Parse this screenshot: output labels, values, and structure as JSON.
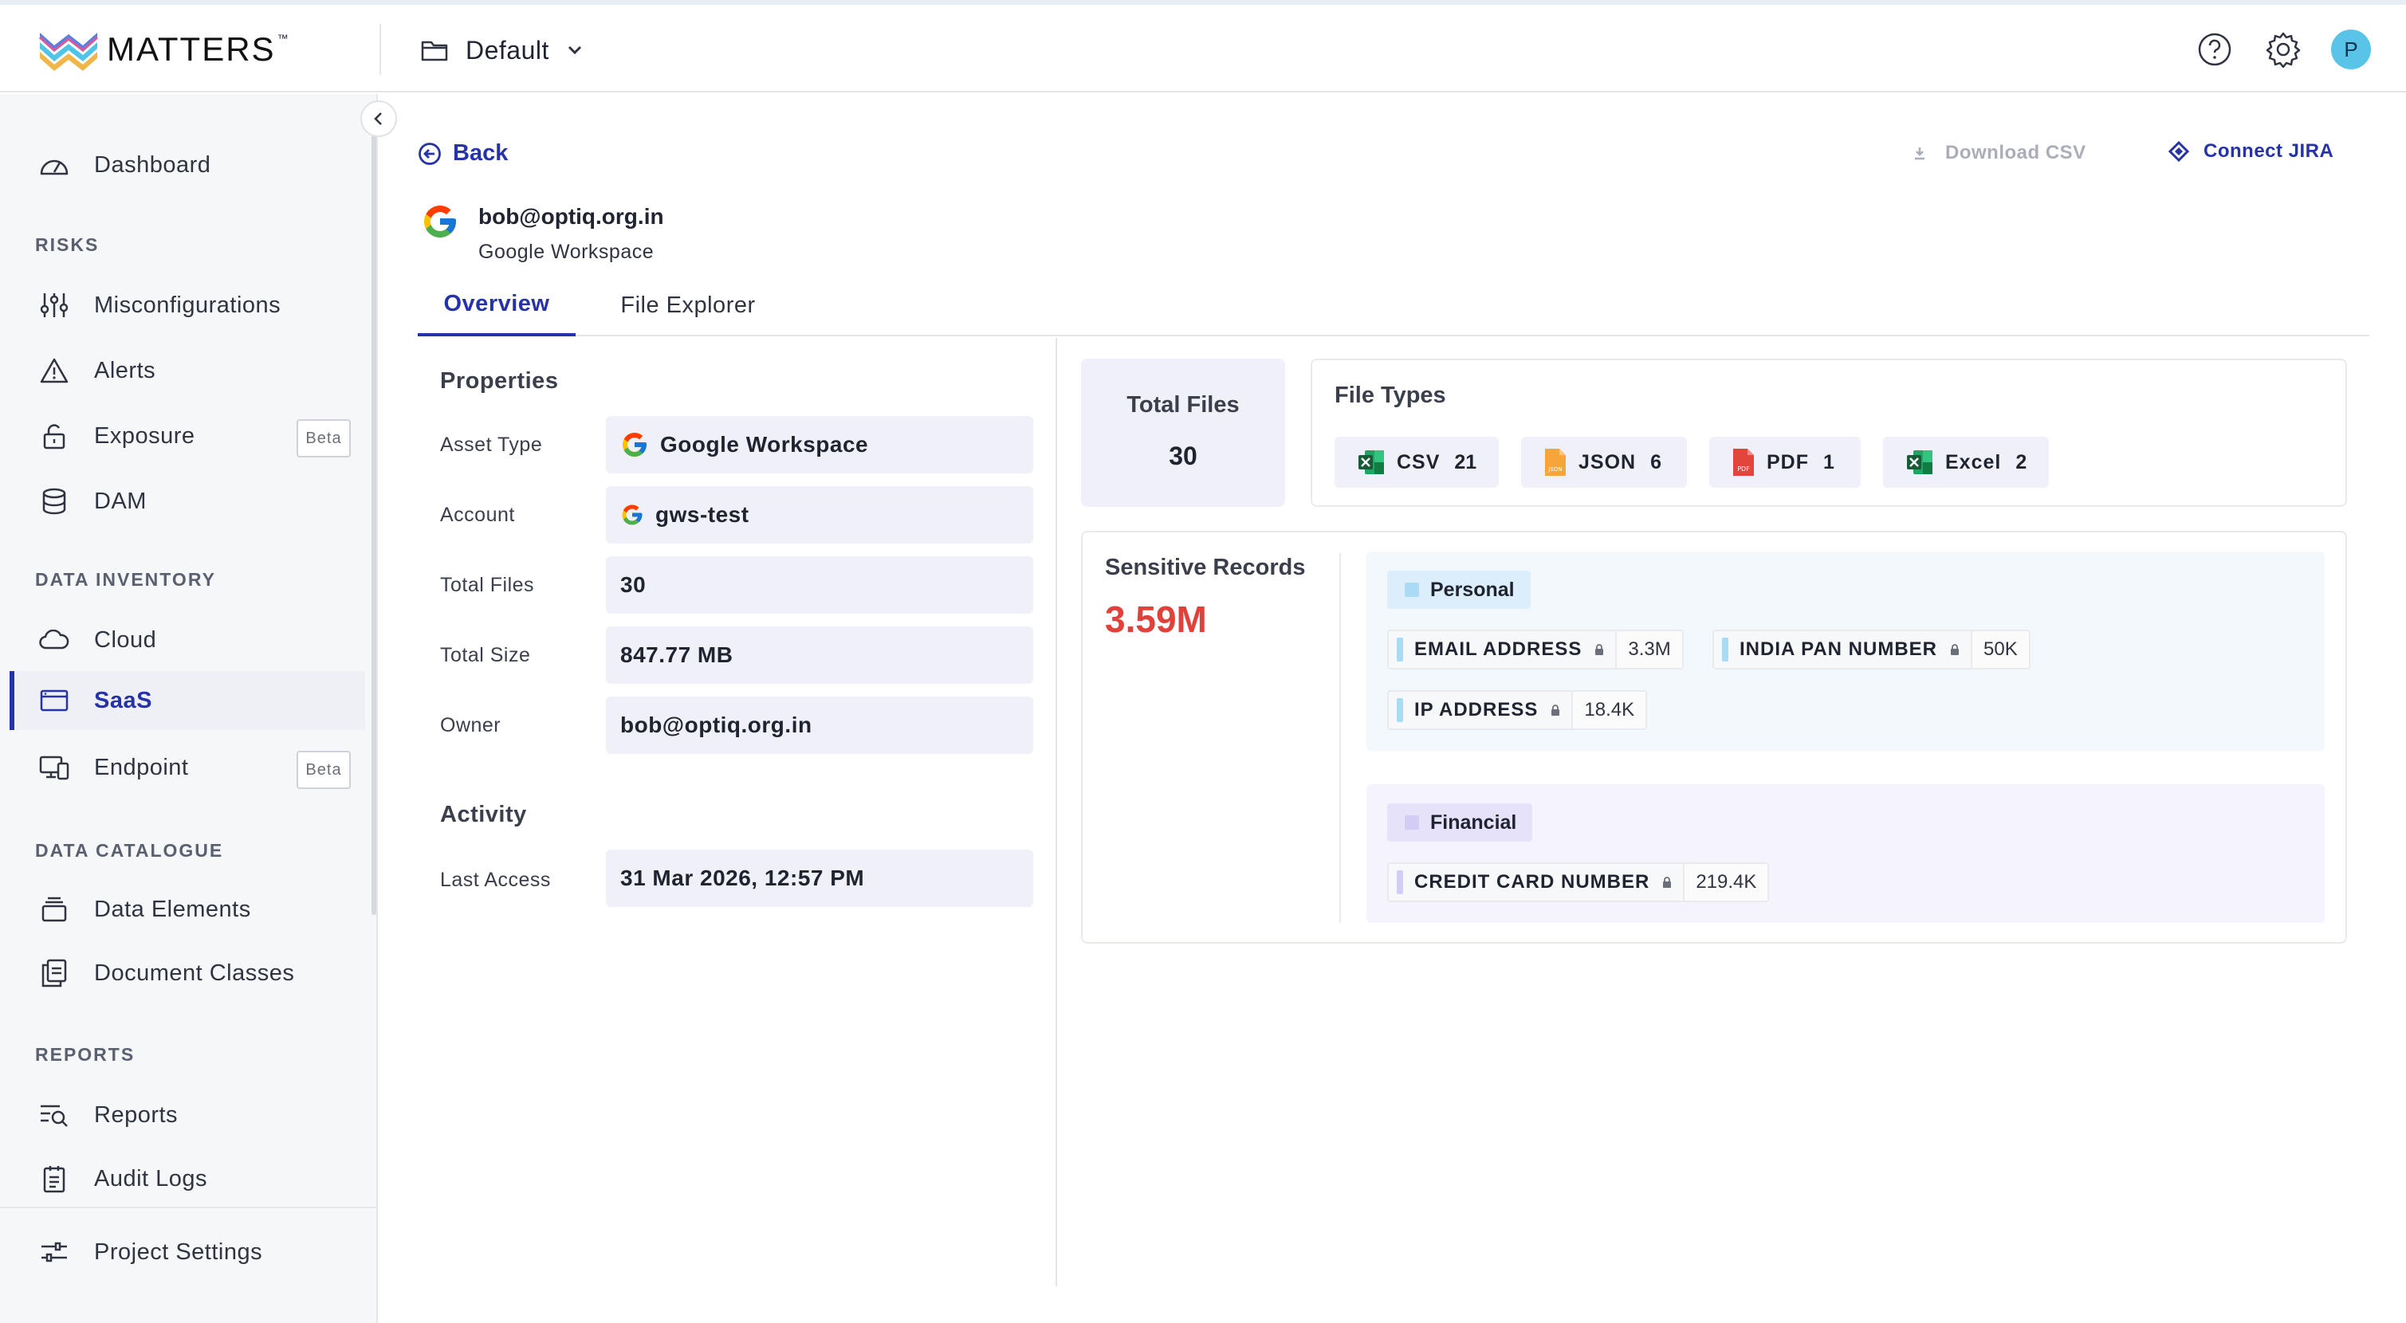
{
  "app": {
    "brand": "MATTERS",
    "brand_tm": "™",
    "project": "Default",
    "avatar_initial": "P",
    "accent_color": "#2633a8"
  },
  "sidebar": {
    "dashboard": "Dashboard",
    "sections": {
      "risks": "RISKS",
      "data_inventory": "DATA INVENTORY",
      "data_catalogue": "DATA CATALOGUE",
      "reports": "REPORTS"
    },
    "items": {
      "misconfigurations": "Misconfigurations",
      "alerts": "Alerts",
      "exposure": "Exposure",
      "dam": "DAM",
      "cloud": "Cloud",
      "saas": "SaaS",
      "endpoint": "Endpoint",
      "data_elements": "Data Elements",
      "document_classes": "Document Classes",
      "reports": "Reports",
      "audit_logs": "Audit Logs",
      "project_settings": "Project Settings"
    },
    "beta_label": "Beta",
    "active_item": "SaaS"
  },
  "header": {
    "back": "Back",
    "download_csv": "Download CSV",
    "connect_jira": "Connect JIRA"
  },
  "asset": {
    "email": "bob@optiq.org.in",
    "provider": "Google Workspace"
  },
  "tabs": {
    "overview": "Overview",
    "file_explorer": "File Explorer",
    "active": "Overview"
  },
  "properties": {
    "title": "Properties",
    "asset_type_label": "Asset Type",
    "asset_type": "Google Workspace",
    "account_label": "Account",
    "account": "gws-test",
    "total_files_label": "Total Files",
    "total_files": "30",
    "total_size_label": "Total Size",
    "total_size": "847.77 MB",
    "owner_label": "Owner",
    "owner": "bob@optiq.org.in"
  },
  "activity": {
    "title": "Activity",
    "last_access_label": "Last Access",
    "last_access": "31 Mar 2026, 12:57 PM"
  },
  "summary": {
    "total_files_title": "Total Files",
    "total_files": "30",
    "file_types_title": "File Types",
    "file_types": [
      {
        "name": "CSV",
        "count": "21",
        "icon": "excel-file-icon"
      },
      {
        "name": "JSON",
        "count": "6",
        "icon": "json-file-icon"
      },
      {
        "name": "PDF",
        "count": "1",
        "icon": "pdf-file-icon"
      },
      {
        "name": "Excel",
        "count": "2",
        "icon": "excel-file-icon"
      }
    ]
  },
  "sensitive": {
    "title": "Sensitive Records",
    "total": "3.59M",
    "total_color": "#e0413a",
    "groups": {
      "personal": {
        "name": "Personal",
        "color": "#a9dbf5",
        "records": [
          {
            "name": "EMAIL ADDRESS",
            "count": "3.3M"
          },
          {
            "name": "INDIA PAN NUMBER",
            "count": "50K"
          },
          {
            "name": "IP ADDRESS",
            "count": "18.4K"
          }
        ]
      },
      "financial": {
        "name": "Financial",
        "color": "#d3cdf6",
        "records": [
          {
            "name": "CREDIT CARD NUMBER",
            "count": "219.4K"
          }
        ]
      }
    }
  }
}
